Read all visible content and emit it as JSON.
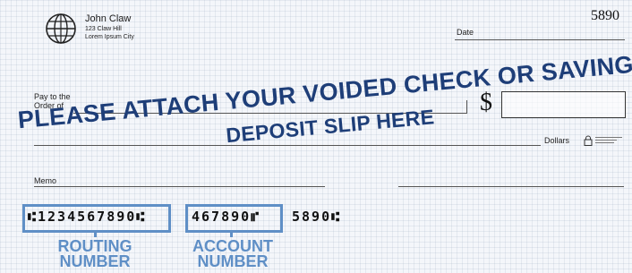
{
  "check": {
    "owner_name": "John Claw",
    "owner_address_line1": "123 Claw Hill",
    "owner_address_line2": "Lorem Ipsum City",
    "check_number": "5890",
    "date_label": "Date",
    "pay_to_label_line1": "Pay to the",
    "pay_to_label_line2": "Order of",
    "dollar_sign": "$",
    "dollars_label": "Dollars",
    "security_icon": "lock-icon",
    "memo_label": "Memo"
  },
  "overlay": {
    "line1": "PLEASE ATTACH YOUR VOIDED CHECK OR SAVINGS",
    "line2": "DEPOSIT SLIP HERE",
    "color": "#1e3e78"
  },
  "micr": {
    "routing": "⑆1234567890⑆",
    "account": "467890⑈",
    "check": "5890⑆"
  },
  "callouts": {
    "routing_label_line1": "ROUTING",
    "routing_label_line2": "NUMBER",
    "account_label_line1": "ACCOUNT",
    "account_label_line2": "NUMBER",
    "color": "#5f8fc6"
  }
}
